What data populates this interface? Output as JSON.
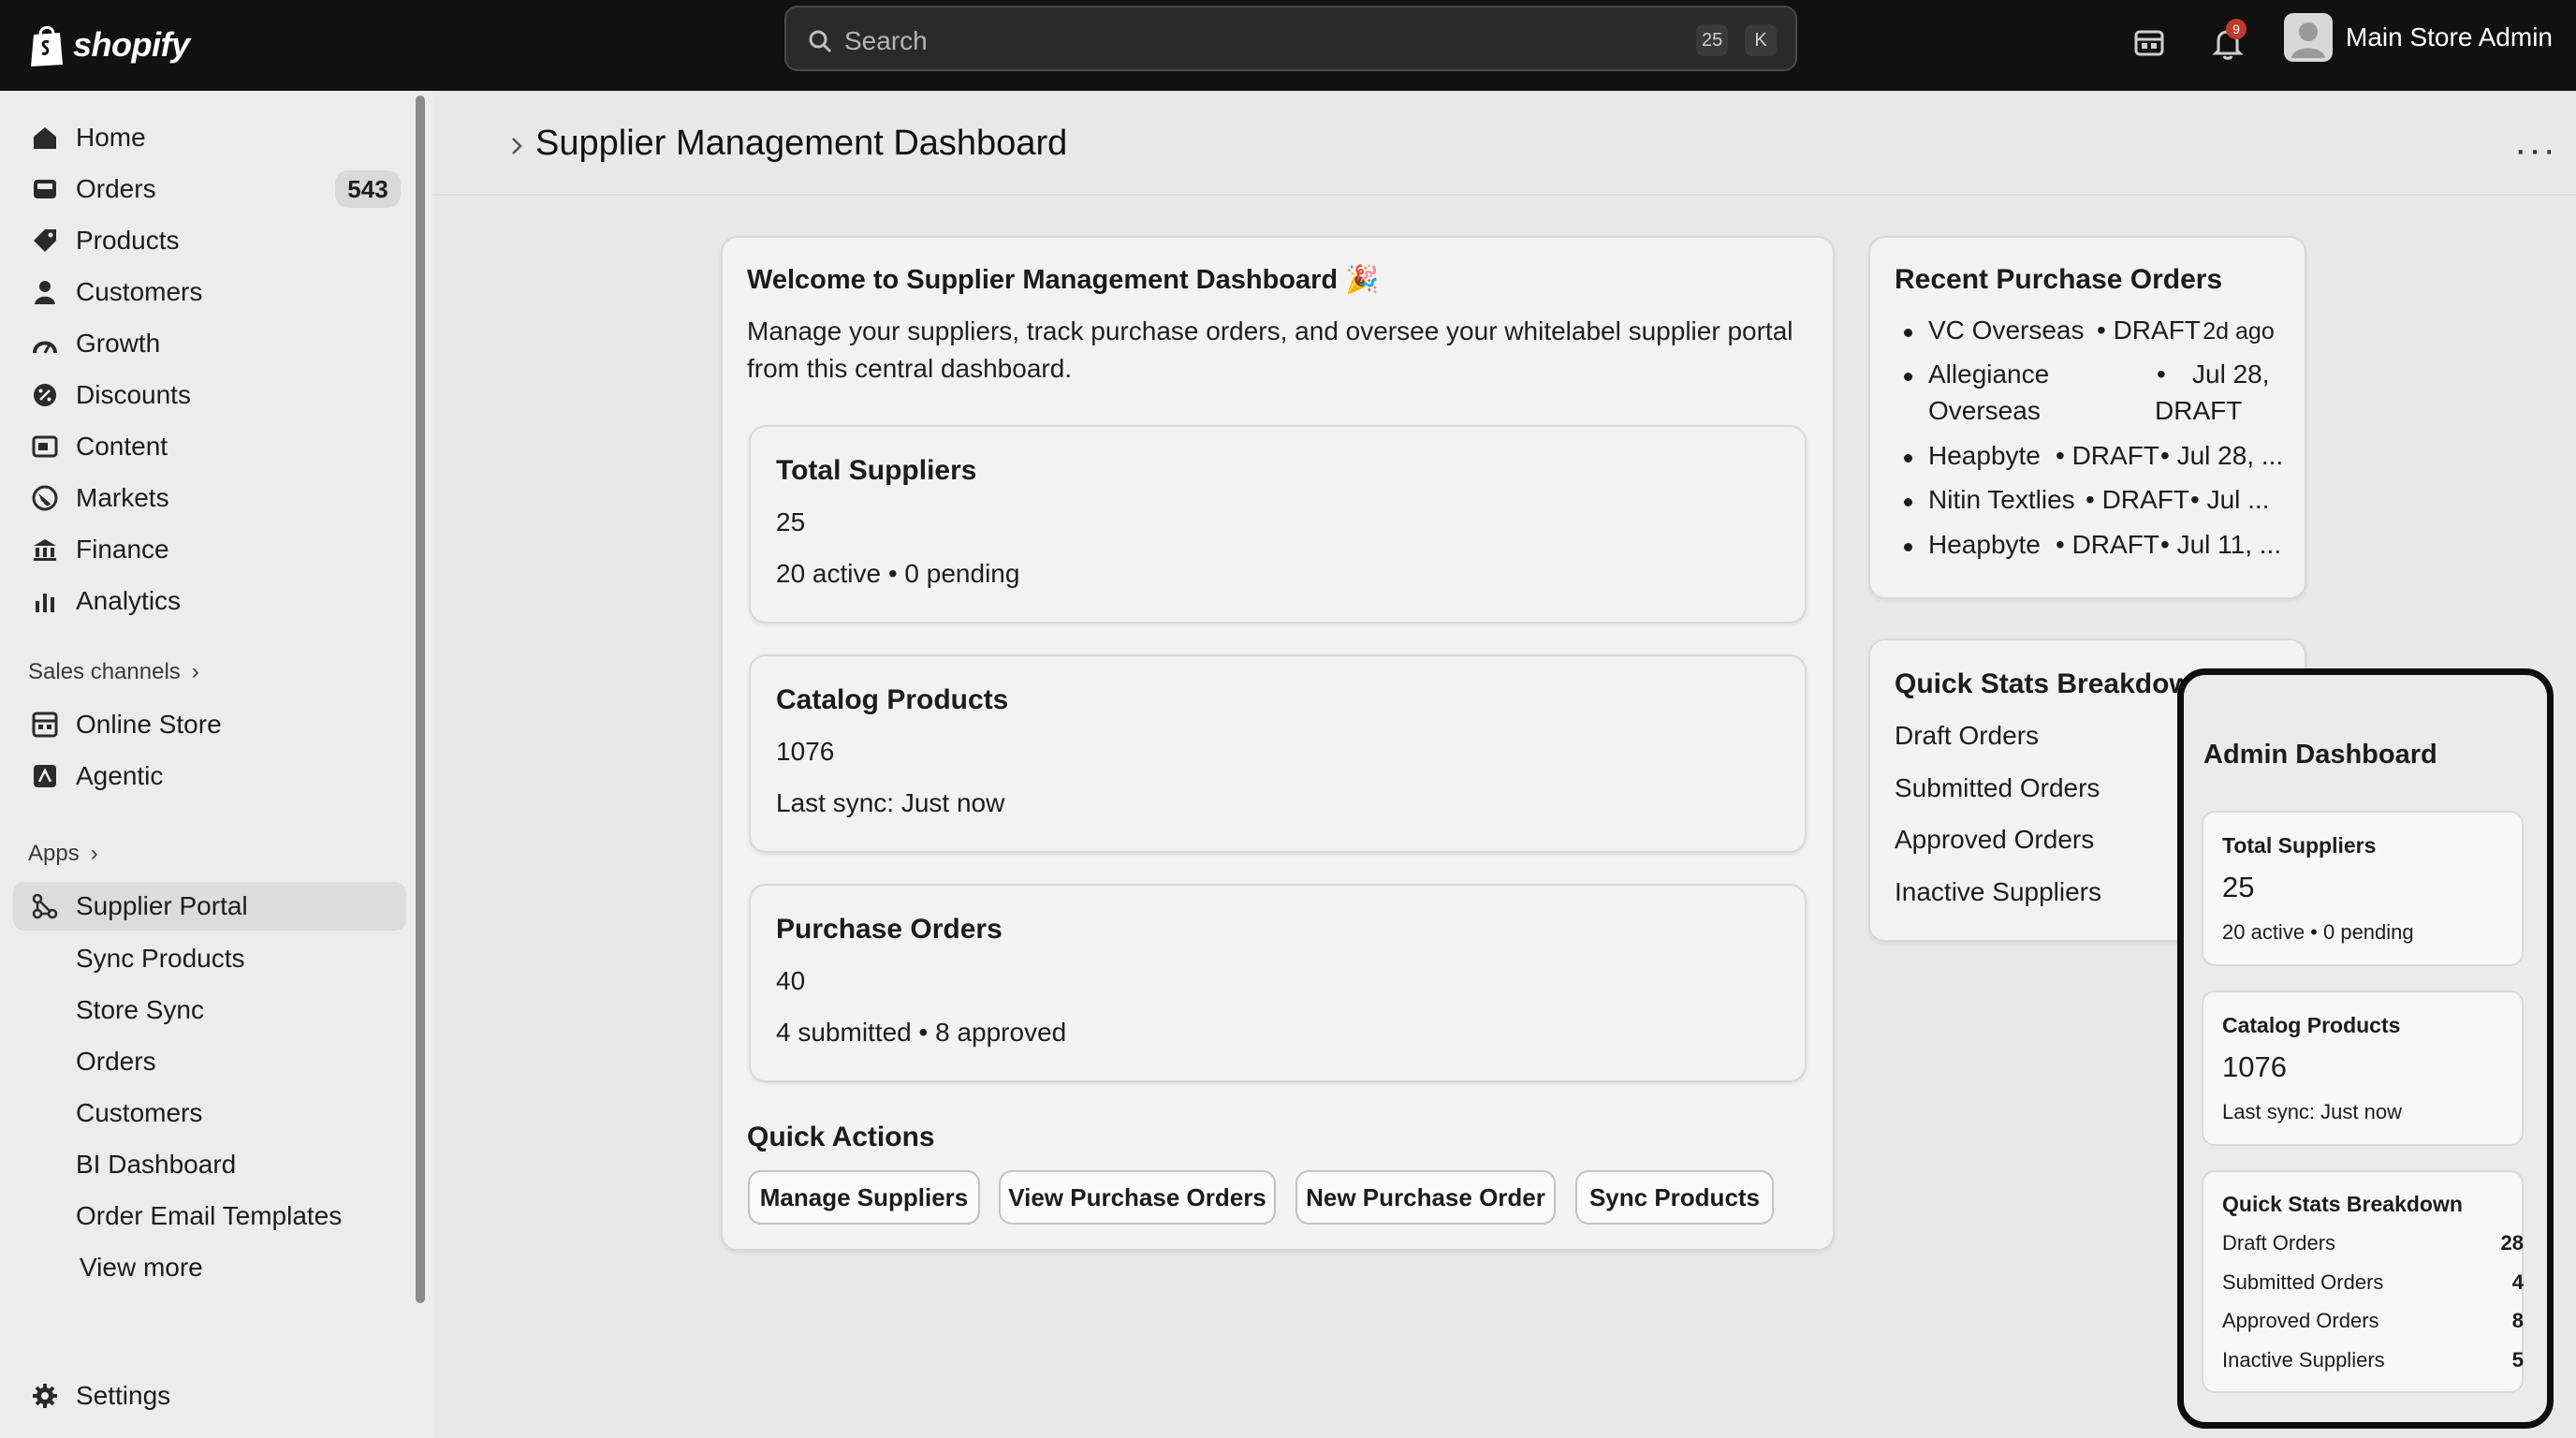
{
  "topbar": {
    "brand": "shopify",
    "search_placeholder": "Search",
    "shortcut_keys": [
      "25",
      "K"
    ],
    "notification_count": "9",
    "user_name": "Main Store Admin"
  },
  "sidebar": {
    "main_items": [
      {
        "label": "Home",
        "icon": "home-icon"
      },
      {
        "label": "Orders",
        "icon": "orders-icon",
        "count": "543"
      },
      {
        "label": "Products",
        "icon": "tag-icon"
      },
      {
        "label": "Customers",
        "icon": "person-icon"
      },
      {
        "label": "Growth",
        "icon": "growth-icon"
      },
      {
        "label": "Discounts",
        "icon": "discount-icon"
      },
      {
        "label": "Content",
        "icon": "content-icon"
      },
      {
        "label": "Markets",
        "icon": "globe-icon"
      },
      {
        "label": "Finance",
        "icon": "bank-icon"
      },
      {
        "label": "Analytics",
        "icon": "bar-chart-icon"
      }
    ],
    "sales_channels_label": "Sales channels",
    "sales_channels": [
      {
        "label": "Online Store",
        "icon": "store-icon"
      },
      {
        "label": "Agentic",
        "icon": "agentic-icon"
      }
    ],
    "apps_label": "Apps",
    "app_active": {
      "label": "Supplier Portal",
      "icon": "supplier-portal-icon"
    },
    "app_subitems": [
      "Sync Products",
      "Store Sync",
      "Orders",
      "Customers",
      "BI Dashboard",
      "Order Email Templates"
    ],
    "view_more": "View more",
    "settings": "Settings"
  },
  "page": {
    "title": "Supplier Management Dashboard",
    "more_label": "···"
  },
  "welcome": {
    "title": "Welcome to Supplier Management Dashboard 🎉",
    "description": "Manage your suppliers, track purchase orders, and oversee your whitelabel supplier portal from this central dashboard."
  },
  "stats": [
    {
      "title": "Total Suppliers",
      "value": "25",
      "sub": "20 active • 0 pending"
    },
    {
      "title": "Catalog Products",
      "value": "1076",
      "sub": "Last sync: Just now"
    },
    {
      "title": "Purchase Orders",
      "value": "40",
      "sub": "4 submitted • 8 approved"
    }
  ],
  "quick_actions": {
    "title": "Quick Actions",
    "buttons": [
      "Manage Suppliers",
      "View Purchase Orders",
      "New Purchase Order",
      "Sync Products"
    ]
  },
  "recent_orders": {
    "title": "Recent Purchase Orders",
    "lines": [
      {
        "a": "VC Overseas",
        "b": "• DRAFT",
        "c": "· 2d ago"
      },
      {
        "a": "Allegiance",
        "a2": "Overseas",
        "b": "•",
        "c": "Jul 28,",
        "c2": "DRAFT"
      },
      {
        "a": "Heapbyte",
        "b": "• DRAFT",
        "c": "• Jul 28, ..."
      },
      {
        "a": "Nitin Textlies",
        "b": "• DRAFT",
        "c": "• Jul ..."
      },
      {
        "a": "Heapbyte",
        "b": "• DRAFT",
        "c": "• Jul 11, ..."
      }
    ]
  },
  "quick_stats": {
    "title": "Quick Stats Breakdown",
    "labels": [
      "Draft Orders",
      "Submitted Orders",
      "Approved Orders",
      "Inactive Suppliers"
    ]
  },
  "admin": {
    "title": "Admin Dashboard",
    "total_suppliers": {
      "title": "Total Suppliers",
      "value": "25",
      "sub": "20 active • 0 pending"
    },
    "catalog": {
      "title": "Catalog Products",
      "value": "1076",
      "sub": "Last sync: Just now"
    },
    "breakdown": {
      "title": "Quick Stats Breakdown",
      "rows": [
        {
          "label": "Draft Orders",
          "value": "28"
        },
        {
          "label": "Submitted Orders",
          "value": "4"
        },
        {
          "label": "Approved Orders",
          "value": "8"
        },
        {
          "label": "Inactive Suppliers",
          "value": "5"
        }
      ]
    }
  }
}
